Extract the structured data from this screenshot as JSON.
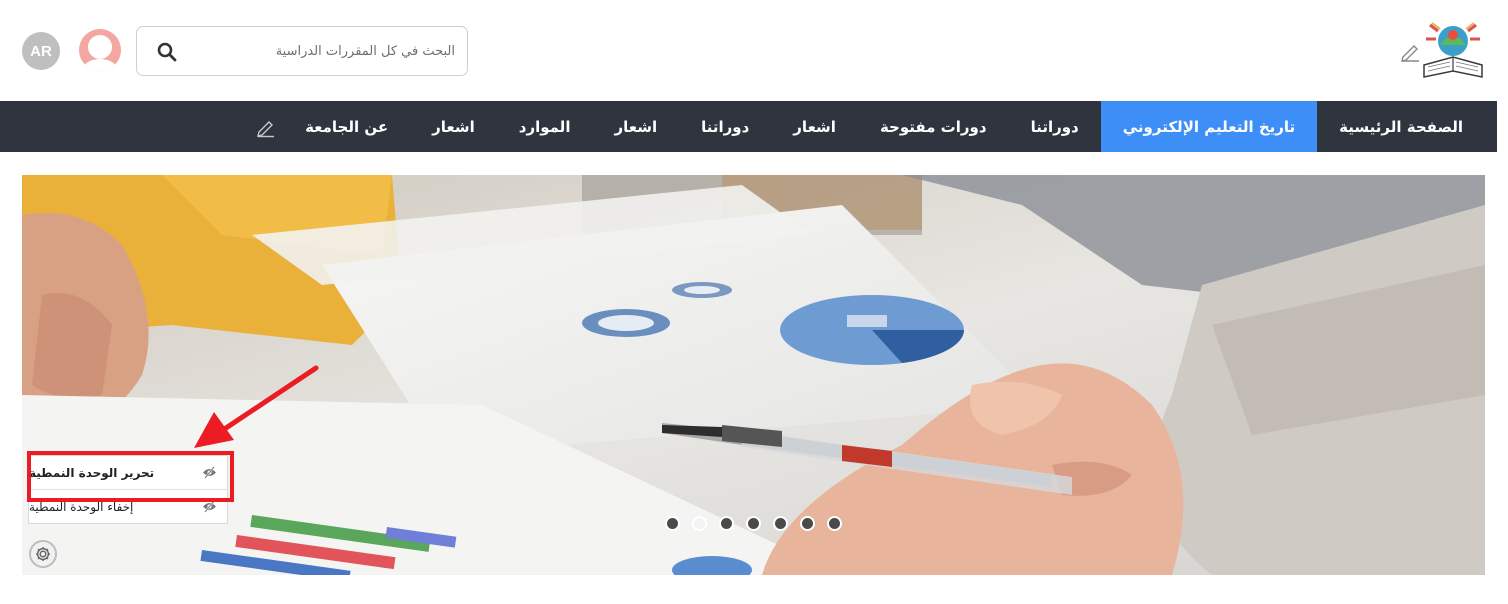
{
  "header": {
    "language_badge": "AR",
    "search": {
      "placeholder": "البحث في كل المقررات الدراسية"
    }
  },
  "nav": {
    "items": [
      {
        "label": "الصفحة الرئيسية",
        "active": false
      },
      {
        "label": "تاريخ التعليم الإلكتروني",
        "active": true
      },
      {
        "label": "دوراتنا",
        "active": false
      },
      {
        "label": "دورات مفتوحة",
        "active": false
      },
      {
        "label": "اشعار",
        "active": false
      },
      {
        "label": "دوراتنا",
        "active": false
      },
      {
        "label": "اشعار",
        "active": false
      },
      {
        "label": "الموارد",
        "active": false
      },
      {
        "label": "اشعار",
        "active": false
      },
      {
        "label": "عن الجامعة",
        "active": false
      }
    ]
  },
  "carousel": {
    "slide_count": 7,
    "active_slide": 2
  },
  "module_menu": {
    "edit_label": "تحرير الوحدة النمطية",
    "hide_label": "إخفاء الوحدة النمطية"
  },
  "colors": {
    "nav_bg": "#2f343e",
    "nav_active": "#3d8ff7",
    "annotation_red": "#ec1c24",
    "avatar_pink": "#f4a6a1"
  }
}
